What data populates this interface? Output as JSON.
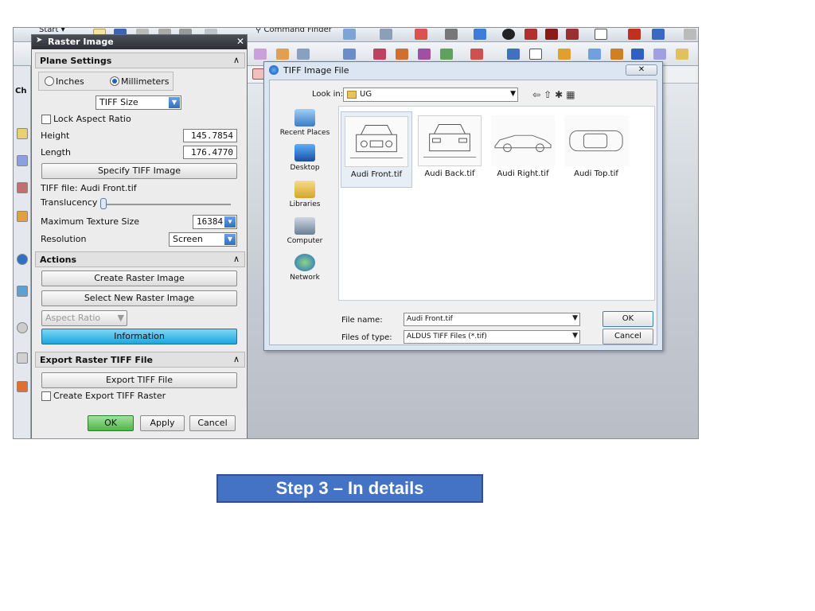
{
  "toolbar": {
    "start_label": "Start",
    "command_finder": "Command Finder"
  },
  "left_strip": {
    "partial_label": "Ch"
  },
  "raster_panel": {
    "title": "Raster Image",
    "plane_settings": {
      "header": "Plane Settings",
      "inches_label": "Inches",
      "millimeters_label": "Millimeters",
      "size_select": "TIFF Size",
      "lock_aspect": "Lock Aspect Ratio",
      "height_label": "Height",
      "height_value": "145.7854",
      "length_label": "Length",
      "length_value": "176.4770",
      "specify_button": "Specify TIFF Image",
      "tiff_file_label": "TIFF file: Audi  Front.tif",
      "translucency_label": "Translucency",
      "max_texture_label": "Maximum Texture Size",
      "max_texture_value": "16384",
      "resolution_label": "Resolution",
      "resolution_value": "Screen"
    },
    "actions": {
      "header": "Actions",
      "create_button": "Create Raster Image",
      "select_new_button": "Select New Raster Image",
      "aspect_ratio_select": "Aspect Ratio",
      "information_button": "Information"
    },
    "export": {
      "header": "Export Raster TIFF File",
      "export_button": "Export TIFF File",
      "create_export_label": "Create Export TIFF Raster"
    },
    "footer": {
      "ok": "OK",
      "apply": "Apply",
      "cancel": "Cancel"
    }
  },
  "file_dialog": {
    "title": "TIFF Image File",
    "look_in_label": "Look in:",
    "look_in_value": "UG",
    "places": [
      "Recent Places",
      "Desktop",
      "Libraries",
      "Computer",
      "Network"
    ],
    "files": [
      "Audi  Front.tif",
      "Audi Back.tif",
      "Audi Right.tif",
      "Audi Top.tif"
    ],
    "file_name_label": "File name:",
    "file_name_value": "Audi  Front.tif",
    "files_of_type_label": "Files of type:",
    "files_of_type_value": "ALDUS TIFF Files (*.tif)",
    "ok": "OK",
    "cancel": "Cancel"
  },
  "caption": "Step 3 – In details"
}
